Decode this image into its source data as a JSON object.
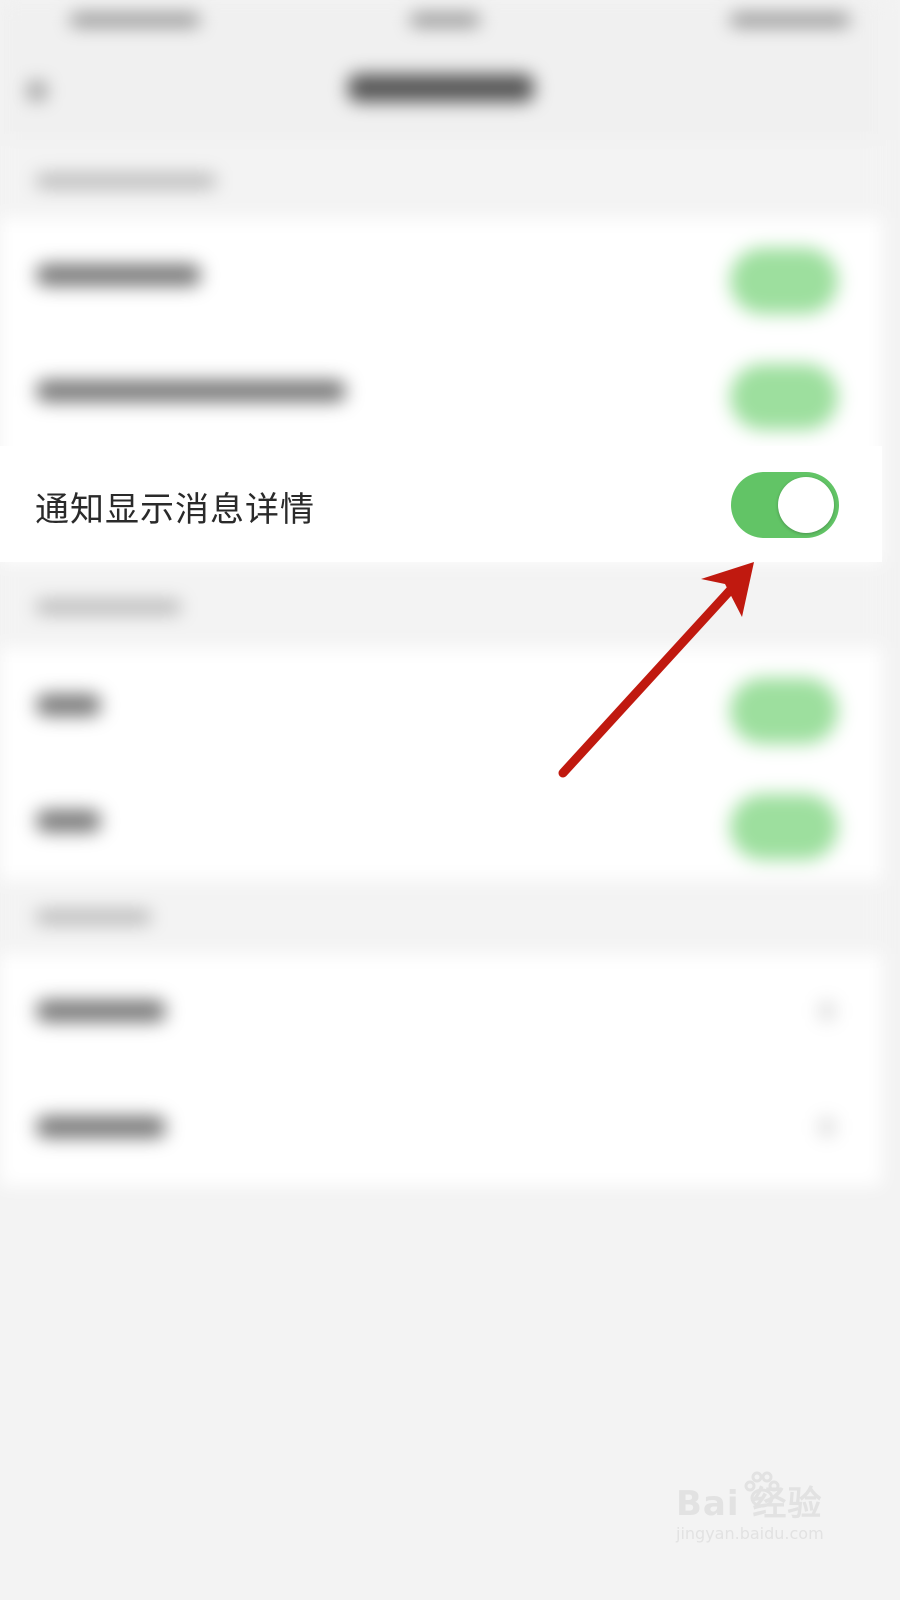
{
  "settings": {
    "notify_detail_label": "通知显示消息详情",
    "notify_detail_enabled": true
  },
  "colors": {
    "toggle_on": "#62c466",
    "annotation_arrow": "#c0190f"
  },
  "watermark": {
    "brand": "Bai  经验",
    "url": "jingyan.baidu.com"
  }
}
